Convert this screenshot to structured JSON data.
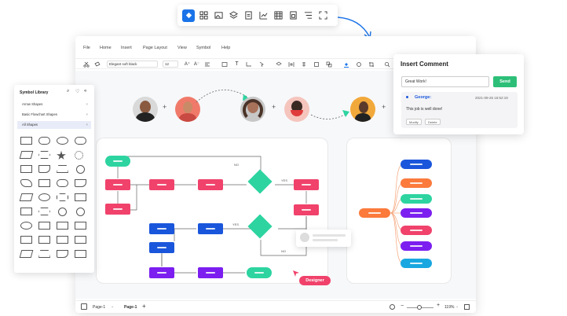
{
  "menu": {
    "file": "File",
    "home": "Home",
    "insert": "Insert",
    "page_layout": "Page Layout",
    "view": "View",
    "symbol": "Symbol",
    "help": "Help"
  },
  "toolbar": {
    "font": "Elegant soft black",
    "font_size": "12"
  },
  "symbol_library": {
    "title": "Symbol Library",
    "categories": [
      {
        "label": "Arrow Shapes"
      },
      {
        "label": "Basic Flowchart Shapes"
      },
      {
        "label": "All Shapes"
      }
    ]
  },
  "comment": {
    "title": "Insert Comment",
    "input_value": "Great Work!",
    "send_label": "Send",
    "author": "George:",
    "timestamp": "2021-09-26 16:52:19",
    "body": "This job is well done!",
    "modify_label": "Modify",
    "delete_label": "Delete"
  },
  "flow_labels": {
    "no1": "NO",
    "yes1": "YES",
    "yes2": "YES",
    "no2": "NO"
  },
  "designer_tag": "Designer",
  "statusbar": {
    "page_tab": "Page-1",
    "current_page": "Page-1",
    "zoom": "119%"
  },
  "colors": {
    "accent": "#1a73e8",
    "green": "#2dd4a0",
    "pink": "#f0426b",
    "blue": "#1a56db",
    "purple": "#7c1ef0",
    "orange": "#fb7a3c",
    "cyan": "#18a7e0",
    "send": "#2dbf78"
  }
}
